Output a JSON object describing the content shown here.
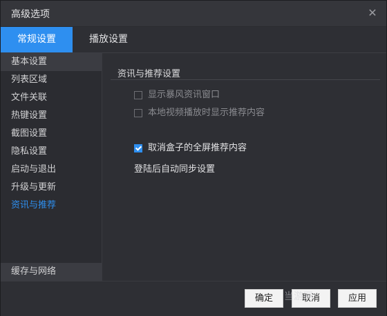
{
  "window": {
    "title": "高级选项"
  },
  "tabs": [
    {
      "label": "常规设置",
      "active": true
    },
    {
      "label": "播放设置",
      "active": false
    }
  ],
  "sidebar": {
    "items": [
      {
        "label": "基本设置"
      },
      {
        "label": "列表区域"
      },
      {
        "label": "文件关联"
      },
      {
        "label": "热键设置"
      },
      {
        "label": "截图设置"
      },
      {
        "label": "隐私设置"
      },
      {
        "label": "启动与退出"
      },
      {
        "label": "升级与更新"
      },
      {
        "label": "资讯与推荐"
      }
    ],
    "bottom_item": "缓存与网络"
  },
  "section": {
    "title": "资讯与推荐设置",
    "options": [
      {
        "label": "显示暴风资讯窗口",
        "checked": false,
        "disabled": true
      },
      {
        "label": "本地视频播放时显示推荐内容",
        "checked": false,
        "disabled": true
      },
      {
        "label": "取消盒子的全屏推荐内容",
        "checked": true,
        "disabled": false
      }
    ],
    "sync_text": "登陆后自动同步设置"
  },
  "footer": {
    "ok": "确定",
    "cancel": "取消",
    "apply": "应用"
  },
  "watermark": "当游网",
  "colors": {
    "accent": "#2e8ff0",
    "background": "#2e2f34"
  }
}
